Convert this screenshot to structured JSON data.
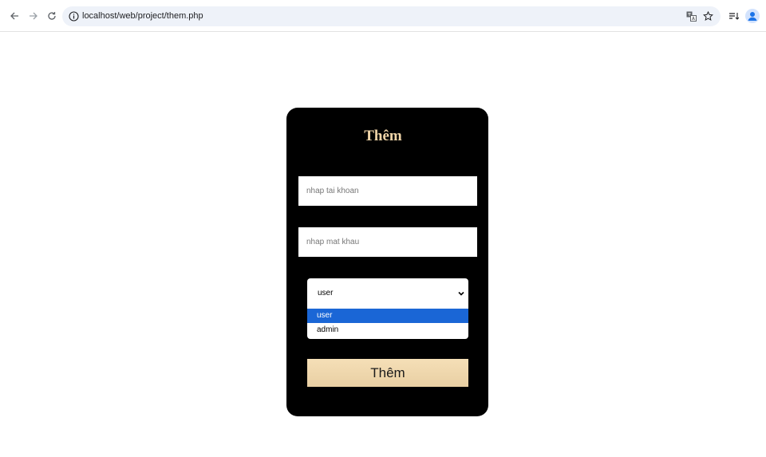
{
  "browser": {
    "url": "localhost/web/project/them.php"
  },
  "form": {
    "title": "Thêm",
    "username_placeholder": "nhap tai khoan",
    "password_placeholder": "nhap mat khau",
    "role_select": {
      "selected": "user",
      "options": [
        "user",
        "admin"
      ]
    },
    "submit_label": "Thêm"
  },
  "colors": {
    "card_bg": "#000000",
    "title_color": "#f0d5a8",
    "button_bg": "#efd7ad",
    "option_highlight": "#1a66d6"
  }
}
